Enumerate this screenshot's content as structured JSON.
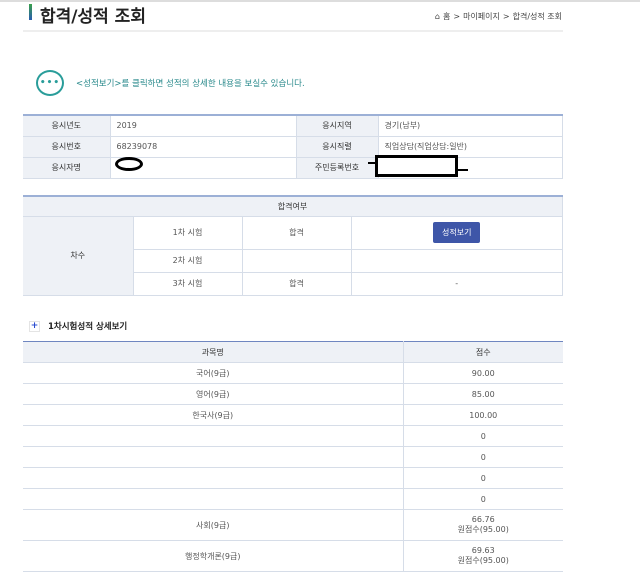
{
  "header": {
    "title": "합격/성적 조회",
    "breadcrumb": [
      "홈",
      "마이페이지",
      "합격/성적 조회"
    ]
  },
  "notice": {
    "icon": "chat-bubble-icon",
    "text": "<성적보기>를 클릭하면 성적의 상세한 내용을 보실수 있습니다."
  },
  "applicant": {
    "year_label": "응시년도",
    "year": "2019",
    "region_label": "응시지역",
    "region": "경기(남부)",
    "number_label": "응시번호",
    "number": "68239078",
    "job_label": "응시직렬",
    "job": "직업상담(직업상담:일반)",
    "name_label": "응시자명",
    "id_label": "주민등록번호"
  },
  "result": {
    "header": "합격여부",
    "round_label": "차수",
    "rows": [
      {
        "exam": "1차 시험",
        "status": "합격",
        "action": "성적보기"
      },
      {
        "exam": "2차 시험",
        "status": "",
        "action": ""
      },
      {
        "exam": "3차 시험",
        "status": "합격",
        "action": "-"
      }
    ]
  },
  "detail": {
    "title": "1차시험성적 상세보기",
    "col_subject": "과목명",
    "col_score": "점수",
    "rows": [
      {
        "subject": "국어(9급)",
        "score": "90.00",
        "raw": ""
      },
      {
        "subject": "영어(9급)",
        "score": "85.00",
        "raw": ""
      },
      {
        "subject": "한국사(9급)",
        "score": "100.00",
        "raw": ""
      },
      {
        "subject": "",
        "score": "0",
        "raw": ""
      },
      {
        "subject": "",
        "score": "0",
        "raw": ""
      },
      {
        "subject": "",
        "score": "0",
        "raw": ""
      },
      {
        "subject": "",
        "score": "0",
        "raw": ""
      },
      {
        "subject": "사회(9급)",
        "score": "66.76",
        "raw": "원점수(95.00)"
      },
      {
        "subject": "행정학개론(9급)",
        "score": "69.63",
        "raw": "원점수(95.00)"
      }
    ]
  }
}
